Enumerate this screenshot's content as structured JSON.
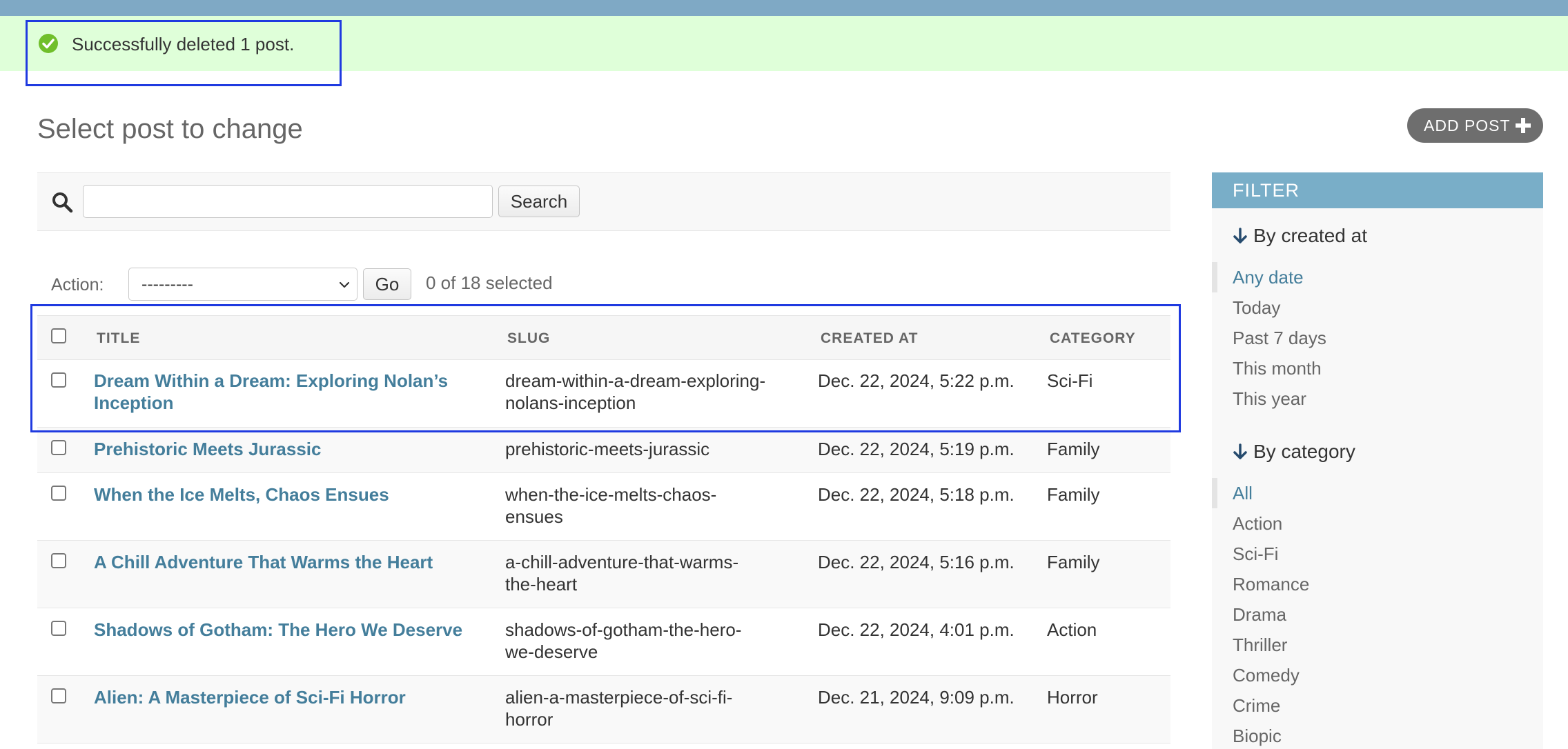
{
  "message": {
    "text": "Successfully deleted 1 post.",
    "status_color": "#dfffd9"
  },
  "header": {
    "title": "Select post to change",
    "add_label": "ADD POST"
  },
  "search": {
    "button_label": "Search",
    "value": ""
  },
  "actions": {
    "label": "Action:",
    "selected_option": "---------",
    "go_label": "Go",
    "selected_count": "0 of 18 selected"
  },
  "table": {
    "columns": [
      "TITLE",
      "SLUG",
      "CREATED AT",
      "CATEGORY"
    ],
    "rows": [
      {
        "title_l1": "Dream Within a Dream: Exploring Nolan’s",
        "title_l2": "Inception",
        "slug_l1": "dream-within-a-dream-exploring-",
        "slug_l2": "nolans-inception",
        "created": "Dec. 22, 2024, 5:22 p.m.",
        "category": "Sci-Fi"
      },
      {
        "title_l1": "Prehistoric Meets Jurassic",
        "title_l2": "",
        "slug_l1": "prehistoric-meets-jurassic",
        "slug_l2": "",
        "created": "Dec. 22, 2024, 5:19 p.m.",
        "category": "Family"
      },
      {
        "title_l1": "When the Ice Melts, Chaos Ensues",
        "title_l2": "",
        "slug_l1": "when-the-ice-melts-chaos-",
        "slug_l2": "ensues",
        "created": "Dec. 22, 2024, 5:18 p.m.",
        "category": "Family"
      },
      {
        "title_l1": "A Chill Adventure That Warms the Heart",
        "title_l2": "",
        "slug_l1": "a-chill-adventure-that-warms-",
        "slug_l2": "the-heart",
        "created": "Dec. 22, 2024, 5:16 p.m.",
        "category": "Family"
      },
      {
        "title_l1": "Shadows of Gotham: The Hero We Deserve",
        "title_l2": "",
        "slug_l1": "shadows-of-gotham-the-hero-",
        "slug_l2": "we-deserve",
        "created": "Dec. 22, 2024, 4:01 p.m.",
        "category": "Action"
      },
      {
        "title_l1": "Alien: A Masterpiece of Sci-Fi Horror",
        "title_l2": "",
        "slug_l1": "alien-a-masterpiece-of-sci-fi-",
        "slug_l2": "horror",
        "created": "Dec. 21, 2024, 9:09 p.m.",
        "category": "Horror"
      }
    ]
  },
  "filter": {
    "title": "FILTER",
    "created_title": "By created at",
    "created_items": [
      "Any date",
      "Today",
      "Past 7 days",
      "This month",
      "This year"
    ],
    "category_title": "By category",
    "category_items": [
      "All",
      "Action",
      "Sci-Fi",
      "Romance",
      "Drama",
      "Thriller",
      "Comedy",
      "Crime",
      "Biopic"
    ]
  },
  "colors": {
    "topbar": "#7fa9c5",
    "link": "#447e9b",
    "filter_header": "#79aec8",
    "highlight": "#1f3ae0"
  }
}
